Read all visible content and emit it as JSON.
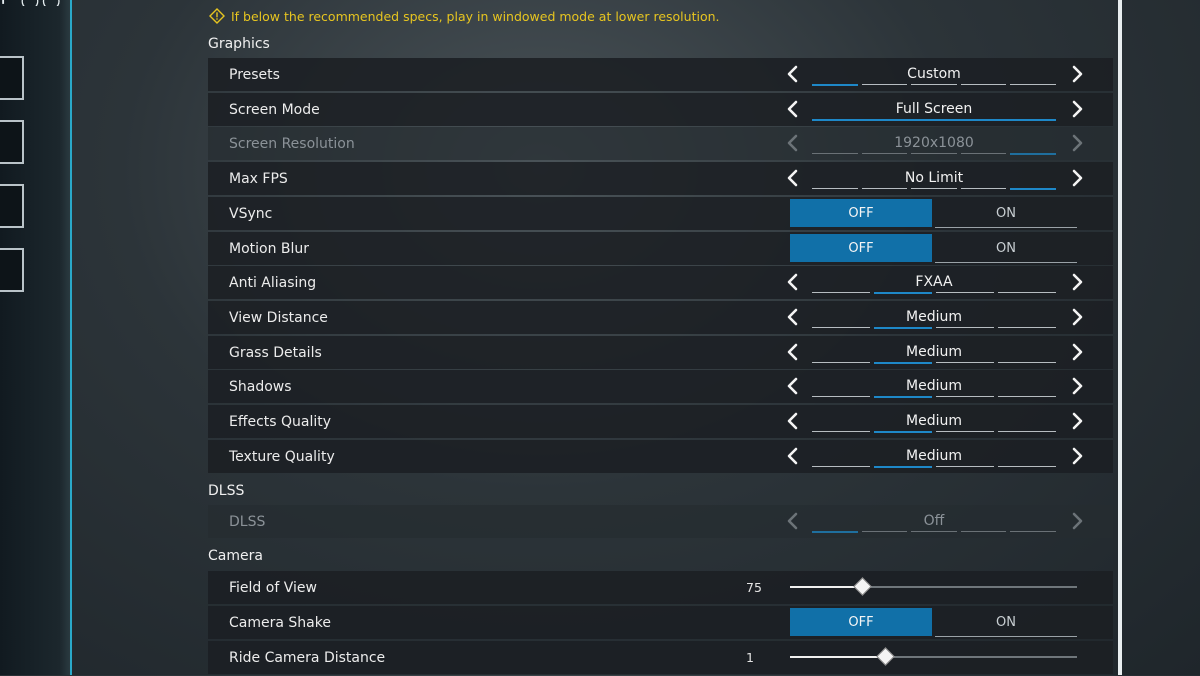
{
  "warning": {
    "icon": "warning-diamond-icon",
    "text": "If below the recommended specs, play in windowed mode at lower resolution."
  },
  "sections": {
    "graphics": "Graphics",
    "dlss": "DLSS",
    "camera": "Camera"
  },
  "settings": {
    "presets": {
      "label": "Presets",
      "value": "Custom",
      "segments": 5,
      "active": 0
    },
    "screen_mode": {
      "label": "Screen Mode",
      "value": "Full Screen",
      "segments": 1,
      "active": 0
    },
    "screen_resolution": {
      "label": "Screen Resolution",
      "value": "1920x1080",
      "segments": 5,
      "active": 4,
      "disabled": true
    },
    "max_fps": {
      "label": "Max FPS",
      "value": "No Limit",
      "segments": 5,
      "active": 4
    },
    "vsync": {
      "label": "VSync",
      "off": "OFF",
      "on": "ON",
      "selected": "OFF"
    },
    "motion_blur": {
      "label": "Motion Blur",
      "off": "OFF",
      "on": "ON",
      "selected": "OFF"
    },
    "anti_aliasing": {
      "label": "Anti Aliasing",
      "value": "FXAA",
      "segments": 4,
      "active": 1
    },
    "view_distance": {
      "label": "View Distance",
      "value": "Medium",
      "segments": 4,
      "active": 1
    },
    "grass_details": {
      "label": "Grass Details",
      "value": "Medium",
      "segments": 4,
      "active": 1
    },
    "shadows": {
      "label": "Shadows",
      "value": "Medium",
      "segments": 4,
      "active": 1
    },
    "effects_quality": {
      "label": "Effects Quality",
      "value": "Medium",
      "segments": 4,
      "active": 1
    },
    "texture_quality": {
      "label": "Texture Quality",
      "value": "Medium",
      "segments": 4,
      "active": 1
    },
    "dlss": {
      "label": "DLSS",
      "value": "Off",
      "segments": 5,
      "active": 0,
      "disabled": true
    },
    "field_of_view": {
      "label": "Field of View",
      "value": "75",
      "fraction": 0.25
    },
    "camera_shake": {
      "label": "Camera Shake",
      "off": "OFF",
      "on": "ON",
      "selected": "OFF"
    },
    "ride_camera_distance": {
      "label": "Ride Camera Distance",
      "value": "1",
      "fraction": 0.33
    }
  },
  "colors": {
    "accent": "#1170a8",
    "warning": "#e7c520",
    "segment_active": "#1e88c8"
  }
}
